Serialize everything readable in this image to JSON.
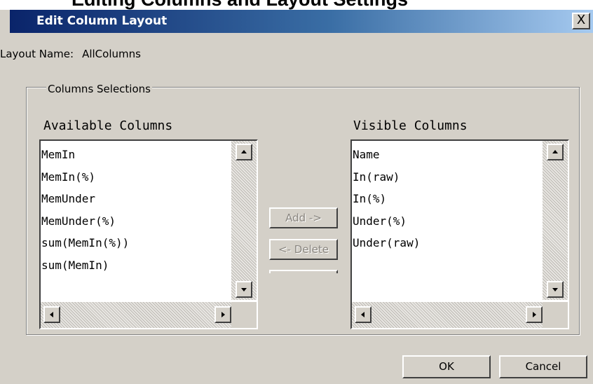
{
  "page_header": "Editing Columns and Layout Settings",
  "dialog": {
    "title": "Edit Column Layout",
    "close_label": "X"
  },
  "layout_name": {
    "label": "Layout Name:",
    "value": "AllColumns"
  },
  "columns_group": {
    "legend": "Columns Selections",
    "available": {
      "heading": "Available Columns",
      "items": [
        "MemIn",
        "MemIn(%)",
        "MemUnder",
        "MemUnder(%)",
        "sum(MemIn(%))",
        "sum(MemIn)"
      ]
    },
    "visible": {
      "heading": "Visible Columns",
      "items": [
        "Name",
        "In(raw)",
        "In(%)",
        "Under(%)",
        "Under(raw)"
      ]
    },
    "add_label": "Add ->",
    "delete_label": "<- Delete"
  },
  "footer": {
    "ok_label": "OK",
    "cancel_label": "Cancel"
  }
}
